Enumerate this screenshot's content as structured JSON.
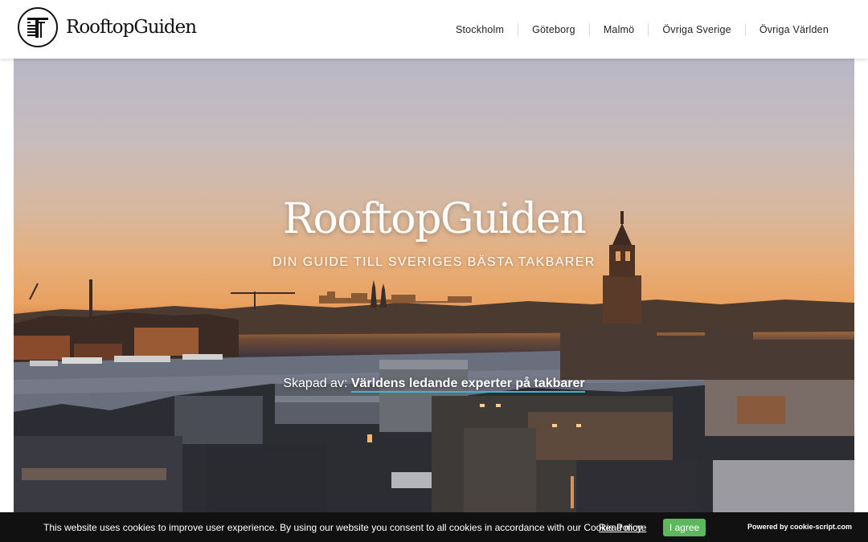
{
  "header": {
    "logo_text": "RooftopGuiden",
    "nav": [
      {
        "label": "Stockholm"
      },
      {
        "label": "Göteborg"
      },
      {
        "label": "Malmö"
      },
      {
        "label": "Övriga Sverige"
      },
      {
        "label": "Övriga Världen"
      }
    ]
  },
  "hero": {
    "title": "RooftopGuiden",
    "subtitle": "DIN GUIDE TILL SVERIGES BÄSTA TAKBARER",
    "credit_prefix": "Skapad av:",
    "credit_link": "Världens ledande experter på takbarer"
  },
  "cookie": {
    "text": "This website uses cookies to improve user experience. By using our website you consent to all cookies in accordance with our Cookie Policy.",
    "read_more": "Read more",
    "agree": "I agree",
    "powered": "Powered by cookie-script.com"
  },
  "colors": {
    "accent_underline": "#3fb7c9",
    "agree_button": "#5cb85c",
    "cookie_bar": "#111111"
  }
}
